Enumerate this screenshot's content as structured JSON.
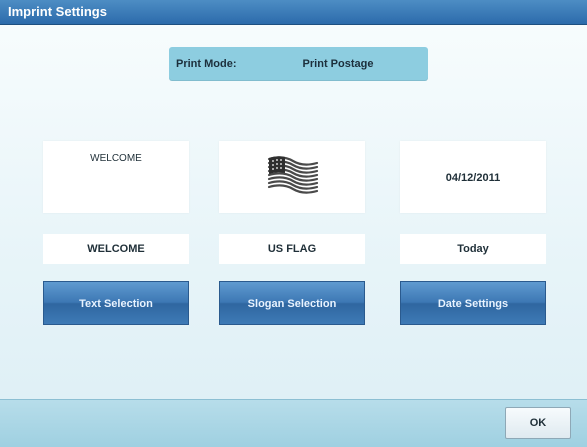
{
  "window": {
    "title": "Imprint Settings"
  },
  "print_mode": {
    "label": "Print Mode:",
    "value": "Print Postage"
  },
  "preview": {
    "text_preview": "WELCOME",
    "slogan_icon": "us-flag-icon",
    "date_preview": "04/12/2011"
  },
  "selections": {
    "text": "WELCOME",
    "slogan": "US FLAG",
    "date": "Today"
  },
  "buttons": {
    "text_selection": "Text Selection",
    "slogan_selection": "Slogan Selection",
    "date_settings": "Date Settings",
    "ok": "OK"
  },
  "colors": {
    "title_bar": "#2c6bab",
    "accent_button": "#3d78b4",
    "mode_bar": "#8dcde0",
    "footer": "#a8d5e5"
  }
}
